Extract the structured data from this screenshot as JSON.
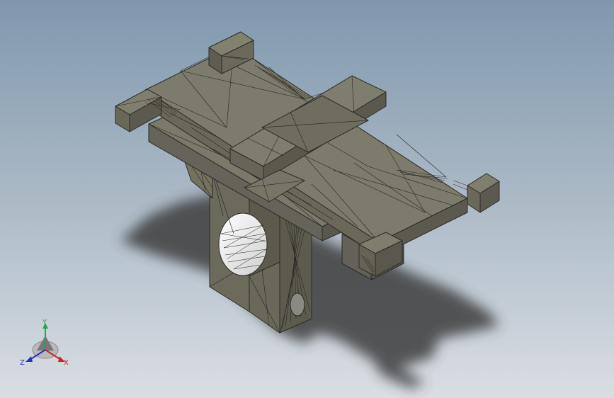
{
  "viewport": {
    "background_top": "#7f98ae",
    "background_bottom": "#d9dee3",
    "model_color_top": "#7d7b6b",
    "model_color_side": "#6a6859",
    "model_color_dark": "#56544a",
    "edge_color": "#2b2b26",
    "shadow_color": "#3a3a3a"
  },
  "triad": {
    "x_label": "X",
    "y_label": "Y",
    "z_label": "Z",
    "x_color": "#d2232a",
    "y_color": "#20a84a",
    "z_color": "#2433c4"
  }
}
